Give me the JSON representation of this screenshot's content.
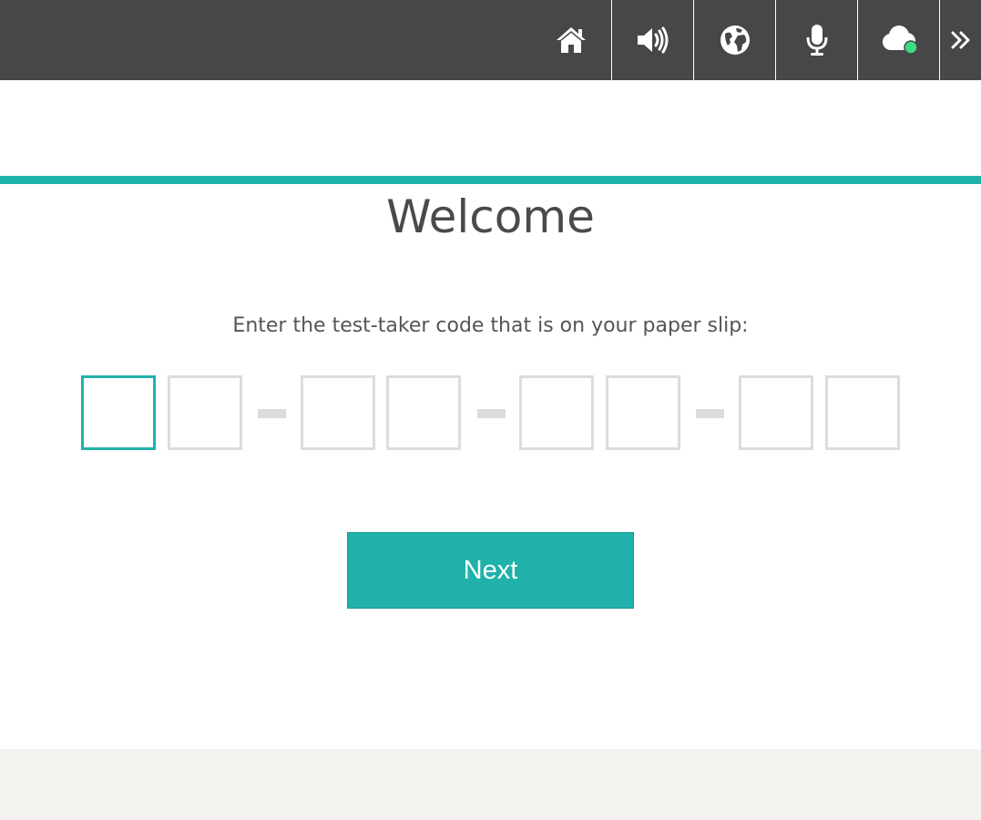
{
  "colors": {
    "toolbar_bg": "#474747",
    "accent": "#20b2aa",
    "box_border": "#dcdcdc",
    "footer_bg": "#f3f2ef",
    "status_dot": "#3ddc84"
  },
  "toolbar": {
    "icons": [
      "home-icon",
      "volume-icon",
      "globe-icon",
      "microphone-icon",
      "cloud-status-icon",
      "double-chevron-right-icon"
    ]
  },
  "main": {
    "title": "Welcome",
    "prompt": "Enter the test-taker code that is on your paper slip:",
    "code_boxes": [
      {
        "value": ""
      },
      {
        "value": ""
      },
      {
        "value": ""
      },
      {
        "value": ""
      },
      {
        "value": ""
      },
      {
        "value": ""
      },
      {
        "value": ""
      },
      {
        "value": ""
      }
    ],
    "next_label": "Next"
  }
}
